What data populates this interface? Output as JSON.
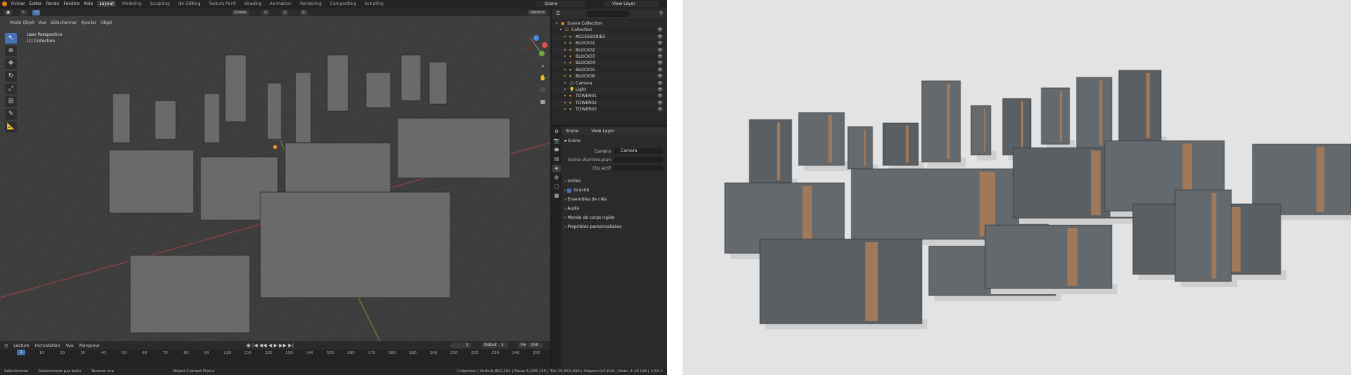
{
  "app": {
    "menu": [
      "Fichier",
      "Éditer",
      "Rendu",
      "Fenêtre",
      "Aide"
    ],
    "workspaces": [
      "Layout",
      "Modeling",
      "Sculpting",
      "UV Editing",
      "Texture Paint",
      "Shading",
      "Animation",
      "Rendering",
      "Compositing",
      "Scripting"
    ],
    "active_workspace": "Layout",
    "scene": "Scene",
    "view_layer": "View Layer"
  },
  "viewport": {
    "mode": "Mode Objet",
    "menus": [
      "Vue",
      "Sélectionner",
      "Ajouter",
      "Objet"
    ],
    "transform": "Global",
    "options": "Options",
    "perspective": "User Perspective",
    "collection_label": "(1) Collection"
  },
  "outliner": {
    "root": "Scene Collection",
    "collection": "Collection",
    "items": [
      "ACCESSORIES",
      "BLOCK01",
      "BLOCK02",
      "BLOCK03",
      "BLOCK04",
      "BLOCK05",
      "BLOCK06",
      "Camera",
      "Light",
      "TOWER01",
      "TOWER02",
      "TOWER03"
    ]
  },
  "properties": {
    "tab_scene": "Scene",
    "tab_view_layer": "View Layer",
    "section": "Scène",
    "camera_label": "Caméra",
    "camera_value": "Camera",
    "background_label": "Scène d'arrière-plan",
    "clip_label": "Clip actif",
    "sections": [
      "Unités",
      "Gravité",
      "Ensembles de clés",
      "Audio",
      "Monde de corps rigide",
      "Propriétés personnalisées"
    ]
  },
  "timeline": {
    "menus": [
      "Lecture",
      "Incrustation",
      "Vue",
      "Marqueur"
    ],
    "current_frame": "1",
    "start_label": "Début",
    "start_value": "1",
    "end_label": "Fin",
    "end_value": "250",
    "ticks": [
      "10",
      "20",
      "30",
      "40",
      "50",
      "60",
      "70",
      "80",
      "90",
      "100",
      "110",
      "120",
      "130",
      "140",
      "150",
      "160",
      "170",
      "180",
      "190",
      "200",
      "210",
      "220",
      "230",
      "240",
      "250"
    ]
  },
  "status": {
    "select": "Sélectionner",
    "box_select": "Sélectionner par boîte",
    "rotate": "Tourner vue",
    "context": "Object Context Menu",
    "stats": "Collection | Verts:6,862,292 | Faces:5,328,135 | Tris:10,653,694 | Objects:0/2,629 | Mem: 4.28 GiB | 2.83.2"
  },
  "colors": {
    "accent": "#4772b3",
    "orange": "#e87d0d",
    "viewport_bg": "#3d3d3d",
    "render_bg": "#e4e4e4"
  }
}
